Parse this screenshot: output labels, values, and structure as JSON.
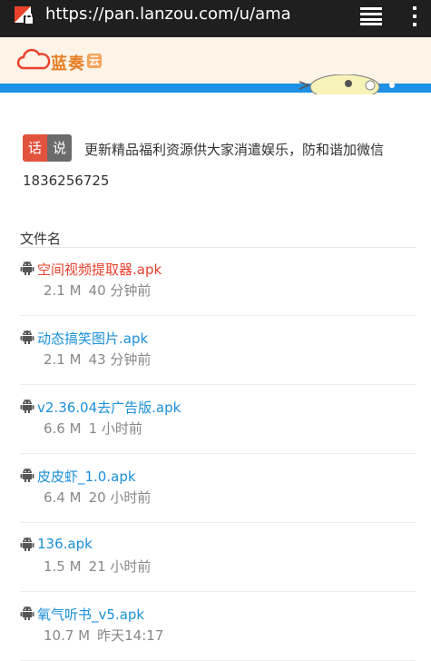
{
  "browser": {
    "url": "https://pan.lanzou.com/u/ama"
  },
  "brand": {
    "name": "蓝奏",
    "badge": "云"
  },
  "notice": {
    "tag_left": "话",
    "tag_right": "说",
    "line1": "更新精品福利资源供大家消遣娱乐，防和谐加微信",
    "line2": "1836256725"
  },
  "list": {
    "header": "文件名",
    "files": [
      {
        "name": "空间视频提取器.apk",
        "size": "2.1 M",
        "time": "40 分钟前",
        "color": "#e8412c"
      },
      {
        "name": "动态搞笑图片.apk",
        "size": "2.1 M",
        "time": "43 分钟前",
        "color": "#1a8fd8"
      },
      {
        "name": "v2.36.04去广告版.apk",
        "size": "6.6 M",
        "time": "1 小时前",
        "color": "#1a8fd8"
      },
      {
        "name": "皮皮虾_1.0.apk",
        "size": "6.4 M",
        "time": "20 小时前",
        "color": "#1a8fd8"
      },
      {
        "name": "136.apk",
        "size": "1.5 M",
        "time": "21 小时前",
        "color": "#1a8fd8"
      },
      {
        "name": "氧气听书_v5.apk",
        "size": "10.7 M",
        "time": "昨天14:17",
        "color": "#1a8fd8"
      }
    ]
  },
  "icons": {
    "site": "lock-warning-icon",
    "tabs": "tabs-icon",
    "menu": "overflow-menu-icon",
    "file": "android-icon",
    "logo": "cloud-icon"
  }
}
